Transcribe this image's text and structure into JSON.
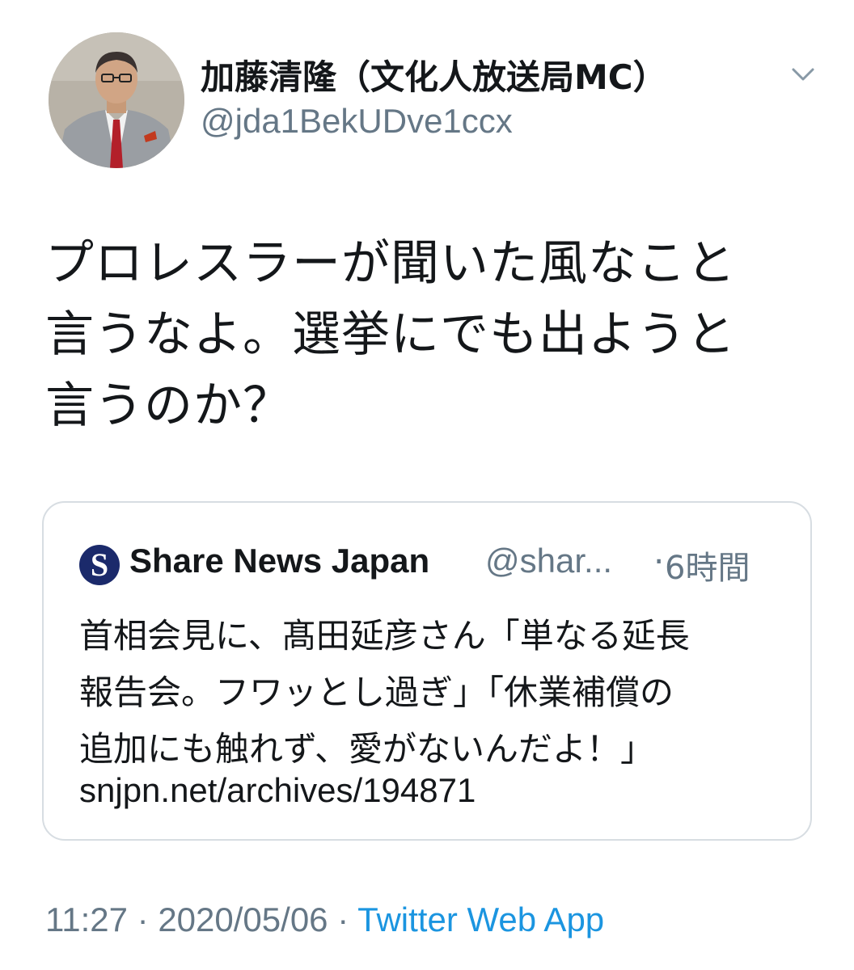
{
  "author": {
    "display_name": "加藤清隆（文化人放送局MC）",
    "handle": "@jda1BekUDve1ccx",
    "avatar_icon": "profile-photo"
  },
  "menu": {
    "caret_icon": "chevron-down-icon"
  },
  "tweet": {
    "text_lines": [
      "プロレスラーが聞いた風なこと",
      "言うなよ。選挙にでも出ようと",
      "言うのか？"
    ]
  },
  "quote": {
    "logo_letter": "S",
    "name": "Share News Japan",
    "handle": "@shar...",
    "separator": "·",
    "time": "6時間",
    "text_lines": [
      "首相会見に、髙田延彦さん「単なる延長",
      "報告会。フワッとし過ぎ」「休業補償の",
      "追加にも触れず、愛がないんだよ！」"
    ],
    "link": "snjpn.net/archives/194871"
  },
  "meta": {
    "time": "11:27",
    "sep1": " · ",
    "date": "2020/05/06",
    "sep2": " · ",
    "source": "Twitter Web App"
  },
  "colors": {
    "text": "#14171a",
    "secondary": "#657786",
    "link": "#1b95e0",
    "border": "#d7dde2",
    "logo": "#1b2a6b"
  }
}
